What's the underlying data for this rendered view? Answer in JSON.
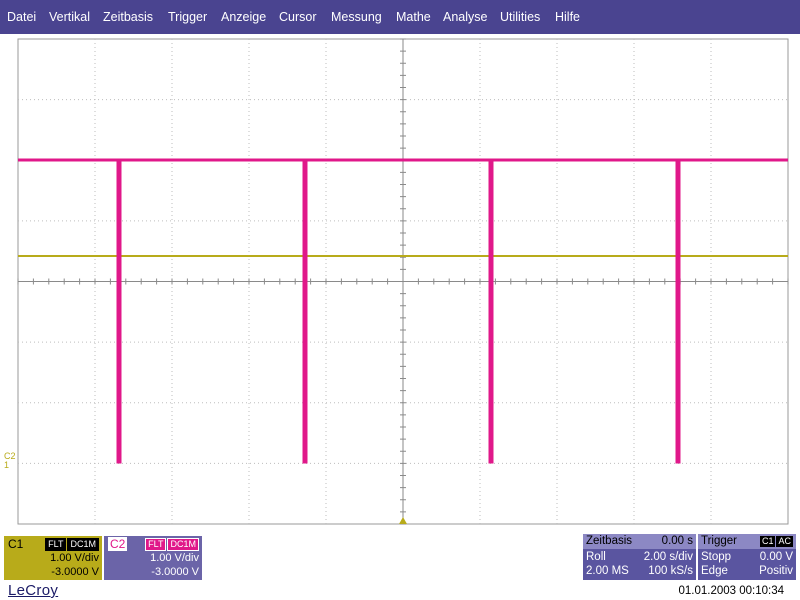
{
  "menu": [
    "Datei",
    "Vertikal",
    "Zeitbasis",
    "Trigger",
    "Anzeige",
    "Cursor",
    "Messung",
    "Mathe",
    "Analyse",
    "Utilities",
    "Hilfe"
  ],
  "colors": {
    "menu_bg": "#4a4490",
    "trace_magenta": "#e0188a",
    "trace_yellow": "#b8ab1a"
  },
  "c1": {
    "name": "C1",
    "coupling": [
      "FLT",
      "DC1M"
    ],
    "vdiv": "1.00 V/div",
    "offset": "-3.0000 V"
  },
  "c2": {
    "name": "C2",
    "coupling": [
      "FLT",
      "DC1M"
    ],
    "vdiv": "1.00 V/div",
    "offset": "-3.0000 V"
  },
  "timebase": {
    "label": "Zeitbasis",
    "delay": "0.00 s",
    "mode": "Roll",
    "tdiv": "2.00 s/div",
    "samples": "2.00 MS",
    "rate": "100 kS/s"
  },
  "trigger": {
    "label": "Trigger",
    "source": [
      "C1",
      "AC"
    ],
    "state": "Stopp",
    "level": "0.00 V",
    "type": "Edge",
    "slope": "Positiv"
  },
  "channel_marker": "C2",
  "logo": "LeCroy",
  "datetime": "01.01.2003 00:10:34"
}
